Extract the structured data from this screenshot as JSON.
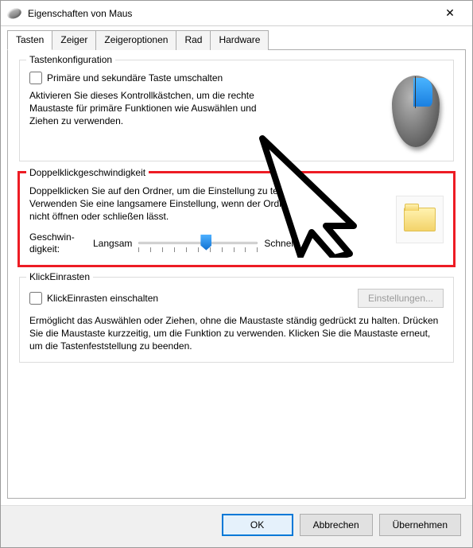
{
  "window": {
    "title": "Eigenschaften von Maus",
    "close_glyph": "✕"
  },
  "tabs": {
    "items": [
      {
        "label": "Tasten",
        "active": true
      },
      {
        "label": "Zeiger",
        "active": false
      },
      {
        "label": "Zeigeroptionen",
        "active": false
      },
      {
        "label": "Rad",
        "active": false
      },
      {
        "label": "Hardware",
        "active": false
      }
    ]
  },
  "group_buttons": {
    "legend": "Tastenkonfiguration",
    "swap_label": "Primäre und sekundäre Taste umschalten",
    "swap_checked": false,
    "description": "Aktivieren Sie dieses Kontrollkästchen, um die rechte Maustaste für primäre Funktionen wie Auswählen und Ziehen zu verwenden."
  },
  "group_doubleclick": {
    "legend": "Doppelklickgeschwindigkeit",
    "description": "Doppelklicken Sie auf den Ordner, um die Einstellung zu testen. Verwenden Sie eine langsamere Einstellung, wenn der Ordner sich nicht öffnen oder schließen lässt.",
    "speed_label": "Geschwin-\ndigkeit:",
    "slow": "Langsam",
    "fast": "Schnell",
    "slider_value": 6,
    "slider_min": 0,
    "slider_max": 10
  },
  "group_clicklock": {
    "legend": "KlickEinrasten",
    "enable_label": "KlickEinrasten einschalten",
    "enable_checked": false,
    "settings_label": "Einstellungen...",
    "settings_enabled": false,
    "description": "Ermöglicht das Auswählen oder Ziehen, ohne die Maustaste ständig gedrückt zu halten. Drücken Sie die Maustaste kurzzeitig, um die Funktion zu verwenden. Klicken Sie die Maustaste erneut, um die Tastenfeststellung zu beenden."
  },
  "footer": {
    "ok": "OK",
    "cancel": "Abbrechen",
    "apply": "Übernehmen"
  },
  "annotation": {
    "arrow_points_to": "group_doubleclick"
  }
}
